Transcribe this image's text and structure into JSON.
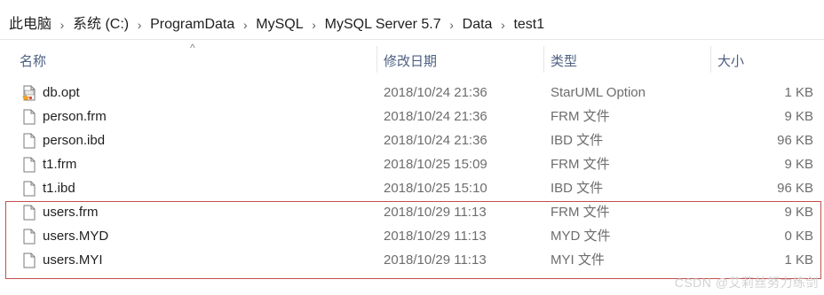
{
  "breadcrumb": {
    "items": [
      "此电脑",
      "系统 (C:)",
      "ProgramData",
      "MySQL",
      "MySQL Server 5.7",
      "Data",
      "test1"
    ],
    "separator": "›"
  },
  "columns": {
    "name": "名称",
    "date": "修改日期",
    "type": "类型",
    "size": "大小"
  },
  "sort_indicator": "^",
  "files": [
    {
      "name": "db.opt",
      "date": "2018/10/24 21:36",
      "type": "StarUML Option",
      "size": "1 KB",
      "icon": "staruml-file-icon"
    },
    {
      "name": "person.frm",
      "date": "2018/10/24 21:36",
      "type": "FRM 文件",
      "size": "9 KB",
      "icon": "file-icon"
    },
    {
      "name": "person.ibd",
      "date": "2018/10/24 21:36",
      "type": "IBD 文件",
      "size": "96 KB",
      "icon": "file-icon"
    },
    {
      "name": "t1.frm",
      "date": "2018/10/25 15:09",
      "type": "FRM 文件",
      "size": "9 KB",
      "icon": "file-icon"
    },
    {
      "name": "t1.ibd",
      "date": "2018/10/25 15:10",
      "type": "IBD 文件",
      "size": "96 KB",
      "icon": "file-icon"
    },
    {
      "name": "users.frm",
      "date": "2018/10/29 11:13",
      "type": "FRM 文件",
      "size": "9 KB",
      "icon": "file-icon"
    },
    {
      "name": "users.MYD",
      "date": "2018/10/29 11:13",
      "type": "MYD 文件",
      "size": "0 KB",
      "icon": "file-icon"
    },
    {
      "name": "users.MYI",
      "date": "2018/10/29 11:13",
      "type": "MYI 文件",
      "size": "1 KB",
      "icon": "file-icon"
    }
  ],
  "watermark": "CSDN @艾莉丝努力练剑",
  "colors": {
    "header_text": "#4d6082",
    "highlight_border": "#c0504d",
    "detail_text": "#6d6d6d"
  }
}
